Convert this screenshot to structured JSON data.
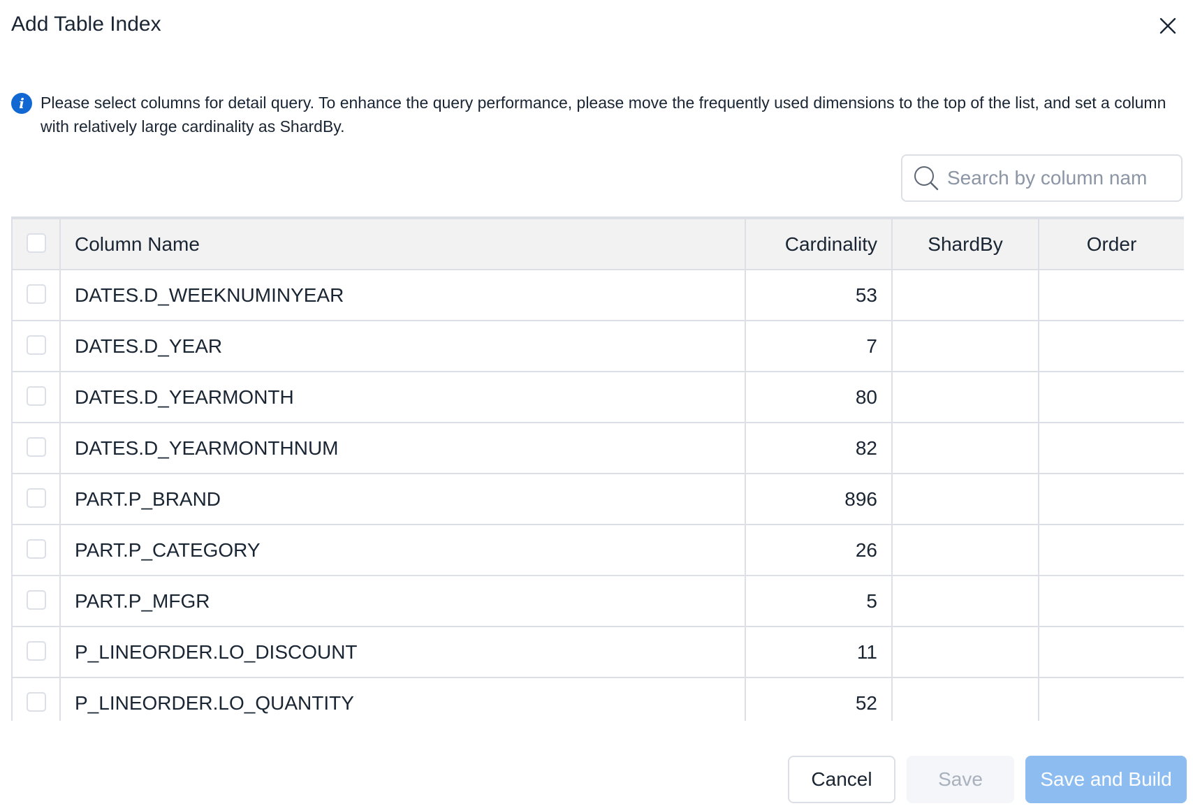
{
  "dialog": {
    "title": "Add Table Index",
    "info_text": "Please select columns for detail query. To enhance the query performance, please move the frequently used dimensions to the top of the list, and set a column with relatively large cardinality as ShardBy.",
    "info_icon": "info-icon",
    "close_icon": "close-icon"
  },
  "search": {
    "placeholder": "Search by column nam",
    "value": "",
    "icon": "search-icon"
  },
  "table": {
    "headers": {
      "column_name": "Column Name",
      "cardinality": "Cardinality",
      "shardby": "ShardBy",
      "order": "Order"
    },
    "rows": [
      {
        "name": "DATES.D_WEEKNUMINYEAR",
        "cardinality": "53",
        "shardby": "",
        "order": ""
      },
      {
        "name": "DATES.D_YEAR",
        "cardinality": "7",
        "shardby": "",
        "order": ""
      },
      {
        "name": "DATES.D_YEARMONTH",
        "cardinality": "80",
        "shardby": "",
        "order": ""
      },
      {
        "name": "DATES.D_YEARMONTHNUM",
        "cardinality": "82",
        "shardby": "",
        "order": ""
      },
      {
        "name": "PART.P_BRAND",
        "cardinality": "896",
        "shardby": "",
        "order": ""
      },
      {
        "name": "PART.P_CATEGORY",
        "cardinality": "26",
        "shardby": "",
        "order": ""
      },
      {
        "name": "PART.P_MFGR",
        "cardinality": "5",
        "shardby": "",
        "order": ""
      },
      {
        "name": "P_LINEORDER.LO_DISCOUNT",
        "cardinality": "11",
        "shardby": "",
        "order": ""
      },
      {
        "name": "P_LINEORDER.LO_QUANTITY",
        "cardinality": "52",
        "shardby": "",
        "order": ""
      }
    ]
  },
  "footer": {
    "cancel_label": "Cancel",
    "save_label": "Save",
    "save_build_label": "Save and Build"
  },
  "colors": {
    "accent": "#1268d3",
    "primary_disabled": "#8dbdf0",
    "border": "#dcdfe6",
    "header_bg": "#f2f2f2"
  }
}
